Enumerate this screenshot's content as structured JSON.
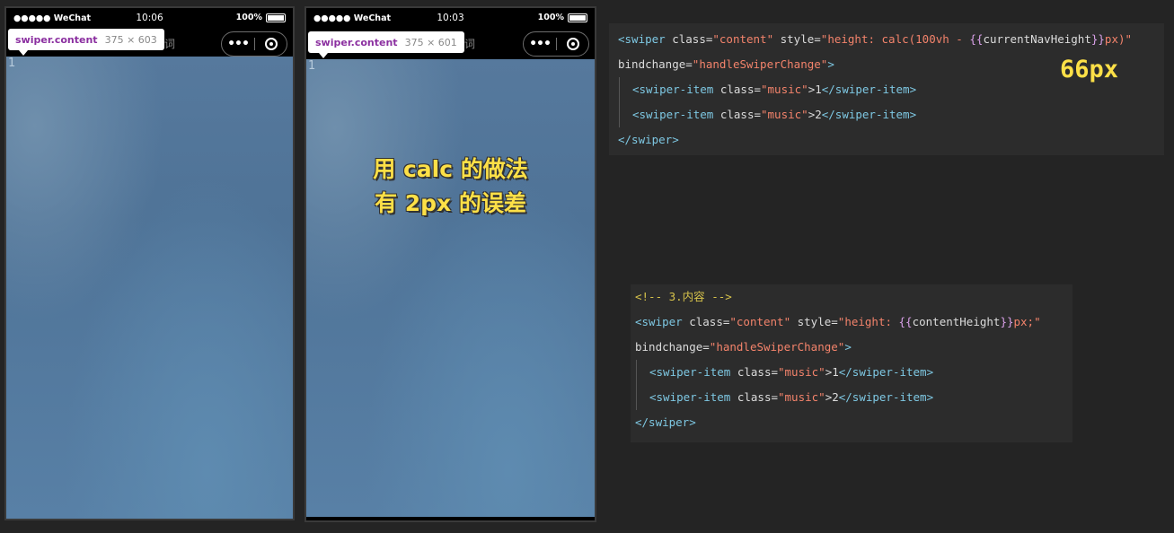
{
  "phones": [
    {
      "status": {
        "carrier": "●●●●● WeChat",
        "time": "10:06",
        "battery": "100%"
      },
      "nav_title": "歌词",
      "tooltip": {
        "selector": "swiper.content",
        "dims": "375 × 603"
      },
      "item_text": "1"
    },
    {
      "status": {
        "carrier": "●●●●● WeChat",
        "time": "10:03",
        "battery": "100%"
      },
      "nav_title": "歌词",
      "tooltip": {
        "selector": "swiper.content",
        "dims": "375 × 601"
      },
      "item_text": "1",
      "overlay": [
        "用 calc 的做法",
        "有 2px 的误差"
      ]
    }
  ],
  "capsule": {
    "menu_icon": "more-dots-icon",
    "close_icon": "target-close-icon",
    "dots": "•••"
  },
  "code1": {
    "open_tag": "<swiper",
    "class_attr": " class=",
    "class_val": "\"content\"",
    "style_attr": " style=",
    "style_val_a": "\"height: calc(100vh - ",
    "style_brace_open": "{{",
    "style_var": "currentNavHeight",
    "style_brace_close": "}}",
    "style_val_b": "px)\"",
    "bind_attr": "bindchange=",
    "bind_val": "\"handleSwiperChange\"",
    "close_angle": ">",
    "items": [
      {
        "open": "<swiper-item",
        "class_attr": " class=",
        "class_val": "\"music\"",
        "text": ">1",
        "close": "</swiper-item>"
      },
      {
        "open": "<swiper-item",
        "class_attr": " class=",
        "class_val": "\"music\"",
        "text": ">2",
        "close": "</swiper-item>"
      }
    ],
    "end_tag": "</swiper>"
  },
  "note": "66px",
  "code2": {
    "comment": "<!-- 3.内容 -->",
    "open_tag": "<swiper",
    "class_attr": " class=",
    "class_val": "\"content\"",
    "style_attr": " style=",
    "style_val_a": "\"height: ",
    "style_brace_open": "{{",
    "style_var": "contentHeight",
    "style_brace_close": "}}",
    "style_val_b": "px;\"",
    "bind_attr": "bindchange=",
    "bind_val": "\"handleSwiperChange\"",
    "close_angle": ">",
    "items": [
      {
        "open": "<swiper-item",
        "class_attr": " class=",
        "class_val": "\"music\"",
        "text": ">1",
        "close": "</swiper-item>"
      },
      {
        "open": "<swiper-item",
        "class_attr": " class=",
        "class_val": "\"music\"",
        "text": ">2",
        "close": "</swiper-item>"
      }
    ],
    "end_tag": "</swiper>"
  },
  "colors": {
    "tag": "#7ec8e3",
    "attr_value": "#f3836b",
    "brace": "#d9a0e8",
    "comment": "#d7c34b",
    "highlight": "#fde047"
  }
}
